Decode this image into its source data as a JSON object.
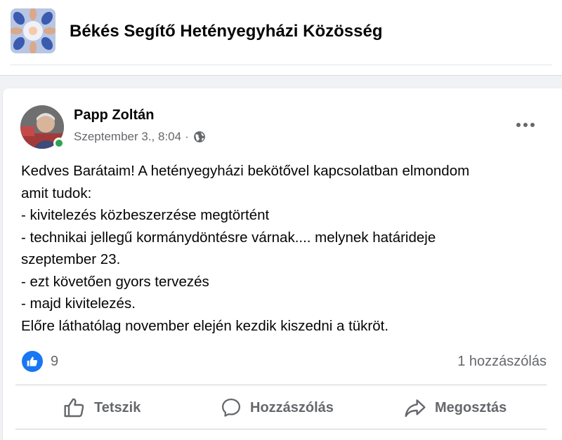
{
  "group": {
    "name": "Békés Segítő Hetényegyházi Közösség"
  },
  "post": {
    "author": "Papp Zoltán",
    "date": "Szeptember 3., 8:04",
    "separator": "·",
    "body_lines": [
      "Kedves Barátaim! A hetényegyházi bekötővel kapcsolatban elmondom",
      "amit tudok:",
      "- kivitelezés közbeszerzése megtörtént",
      "- technikai jellegű kormánydöntésre várnak.... melynek határideje",
      "szeptember 23.",
      "- ezt követően gyors tervezés",
      "- majd kivitelezés.",
      "Előre láthatólag november elején kezdik kiszedni a tükröt."
    ],
    "reactions_count": "9",
    "comments_count": "1 hozzászólás",
    "actions": {
      "like": "Tetszik",
      "comment": "Hozzászólás",
      "share": "Megosztás"
    }
  },
  "colors": {
    "brand_blue": "#1877f2",
    "online_green": "#31a24c",
    "secondary_text": "#65676b",
    "background": "#f0f2f5"
  },
  "icons": {
    "globe": "globe-icon",
    "more": "more-options-icon",
    "like_reaction": "thumbs-up-icon",
    "like_action": "thumbs-up-outline-icon",
    "comment_action": "speech-bubble-icon",
    "share_action": "share-arrow-icon"
  }
}
